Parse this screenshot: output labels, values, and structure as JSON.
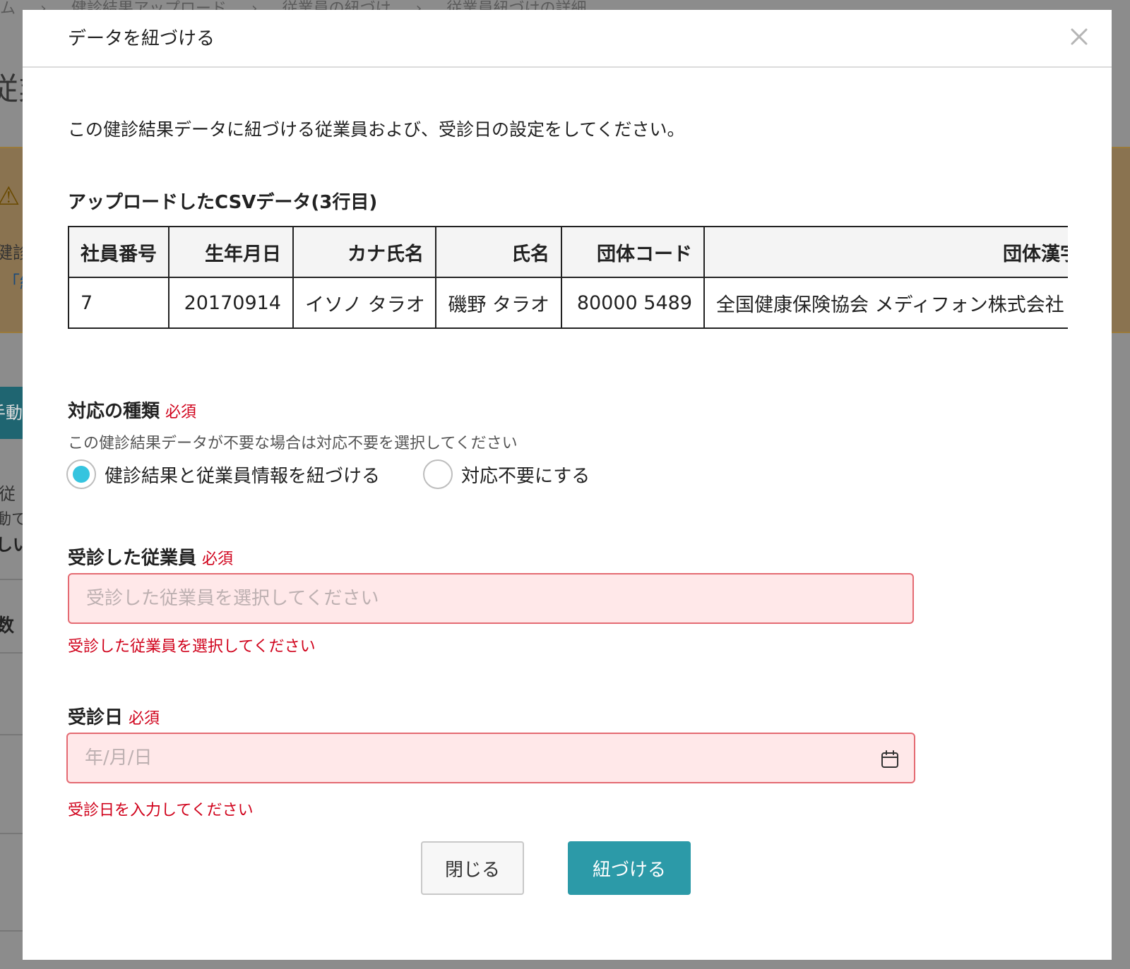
{
  "background": {
    "breadcrumb": [
      "ム",
      "健診結果アップロード",
      "従業員の紐づけ",
      "従業員紐づけの詳細"
    ],
    "page_title_fragment": "従業",
    "warning_icon": "warning-icon",
    "warning_text_fragment": "健診",
    "warning_link_fragment": "「紐",
    "teal_button_fragment": "手動",
    "text_fragment_1": "従",
    "text_fragment_2": "動て",
    "text_fragment_3": "しい",
    "text_fragment_4": "数"
  },
  "modal": {
    "title": "データを紐づける",
    "close_icon": "close-icon",
    "intro": "この健診結果データに紐づける従業員および、受診日の設定をしてください。",
    "csv": {
      "heading": "アップロードしたCSVデータ(3行目)",
      "columns": [
        "社員番号",
        "生年月日",
        "カナ氏名",
        "氏名",
        "団体コード",
        "団体漢字名称"
      ],
      "row": [
        "7",
        "20170914",
        "イソノ タラオ",
        "磯野 タラオ",
        "80000 5489",
        "全国健康保険協会 メディフォン株式会社"
      ]
    },
    "response_type": {
      "label": "対応の種類",
      "required": "必須",
      "helper": "この健診結果データが不要な場合は対応不要を選択してください",
      "options": [
        {
          "label": "健診結果と従業員情報を紐づける",
          "selected": true
        },
        {
          "label": "対応不要にする",
          "selected": false
        }
      ],
      "selected_color": "#35c4df"
    },
    "employee": {
      "label": "受診した従業員",
      "required": "必須",
      "placeholder": "受診した従業員を選択してください",
      "value": "",
      "error": "受診した従業員を選択してください"
    },
    "exam_date": {
      "label": "受診日",
      "required": "必須",
      "placeholder": "年/月/日",
      "value": "",
      "icon": "calendar-icon",
      "error": "受診日を入力してください"
    },
    "buttons": {
      "close": "閉じる",
      "link": "紐づける"
    },
    "colors": {
      "primary": "#2c9aa8",
      "error": "#d0021b",
      "error_bg": "#ffe8e9"
    }
  }
}
